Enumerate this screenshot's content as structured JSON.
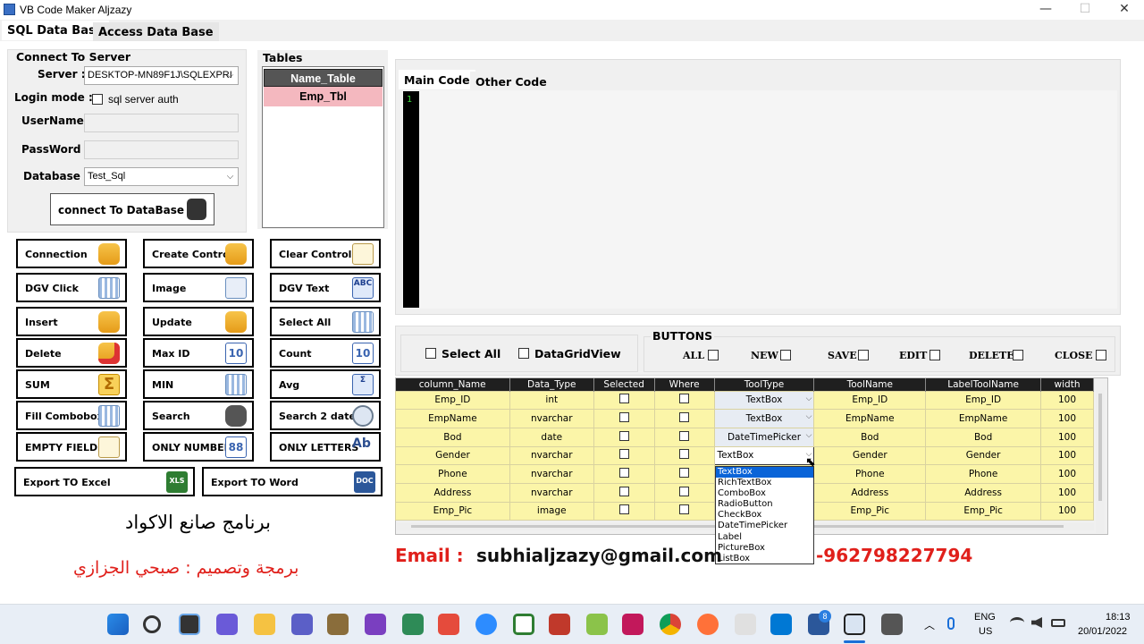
{
  "window": {
    "title": "VB Code Maker Aljzazy",
    "min": "—",
    "max": "☐",
    "close": "✕"
  },
  "tabs": [
    {
      "label": "SQL Data Base"
    },
    {
      "label": "Access Data Base"
    }
  ],
  "connect": {
    "group_title": "Connect To Server",
    "server_label": "Server :",
    "server_value": "DESKTOP-MN89F1J\\SQLEXPRI",
    "login_label": "Login mode :",
    "sql_auth_label": "sql server auth",
    "username_label": "UserName :",
    "password_label": "PassWord :",
    "database_label": "Database :",
    "database_value": "Test_Sql",
    "connect_button": "connect To DataBase"
  },
  "tables": {
    "group_title": "Tables",
    "header": "Name_Table",
    "items": [
      "Emp_Tbl"
    ]
  },
  "buttons": [
    "Connection",
    "Create Controls",
    "Clear Controls",
    "DGV Click",
    "Image",
    "DGV  Text",
    "Insert",
    "Update",
    "Select All",
    "Delete",
    "Max ID",
    "Count",
    "SUM",
    "MIN",
    "Avg",
    "Fill Combobox",
    "Search",
    "Search 2 date",
    "EMPTY FIELD",
    "ONLY NUMBER",
    "ONLY LETTERS",
    "Export TO Excel",
    "Export TO Word"
  ],
  "icons": {
    "Connection": "database-icon",
    "Create Controls": "gear-icon",
    "Clear Controls": "clipboard-icon",
    "DGV Click": "grid-icon",
    "Image": "image-icon",
    "DGV  Text": "abc-icon",
    "Insert": "database-gear-icon",
    "Update": "pencil-icon",
    "Select All": "grid-check-icon",
    "Delete": "database-delete-icon",
    "Max ID": "sort-icon",
    "Count": "count-icon",
    "SUM": "sigma-icon",
    "MIN": "grid-icon",
    "Avg": "sigma-icon",
    "Fill Combobox": "list-icon",
    "Search": "binoculars-icon",
    "Search 2 date": "clock-icon",
    "EMPTY FIELD": "document-delete-icon",
    "ONLY NUMBER": "number-icon",
    "ONLY LETTERS": "letters-icon",
    "Export TO Excel": "excel-icon",
    "Export TO Word": "word-icon"
  },
  "credits": {
    "app_name_ar": "برنامج صانع الاكواد",
    "author_ar": "برمجة وتصميم : صبحي الجزازي"
  },
  "code_tabs": [
    {
      "label": "Main Code"
    },
    {
      "label": "Other Code"
    }
  ],
  "editor": {
    "line_number": "1"
  },
  "options": {
    "select_all": "Select All",
    "datagridview": "DataGridView",
    "buttons_title": "BUTTONS",
    "buttons": [
      "ALL",
      "NEW",
      "SAVE",
      "EDIT",
      "DELETE",
      "CLOSE"
    ]
  },
  "grid": {
    "columns": [
      "column_Name",
      "Data_Type",
      "Selected",
      "Where",
      "ToolType",
      "ToolName",
      "LabelToolName",
      "width"
    ],
    "rows": [
      [
        "Emp_ID",
        "int",
        "",
        "",
        "TextBox",
        "Emp_ID",
        "Emp_ID",
        "100"
      ],
      [
        "EmpName",
        "nvarchar",
        "",
        "",
        "TextBox",
        "EmpName",
        "EmpName",
        "100"
      ],
      [
        "Bod",
        "date",
        "",
        "",
        "DateTimePicker",
        "Bod",
        "Bod",
        "100"
      ],
      [
        "Gender",
        "nvarchar",
        "",
        "",
        "TextBox",
        "Gender",
        "Gender",
        "100"
      ],
      [
        "Phone",
        "nvarchar",
        "",
        "",
        "",
        "Phone",
        "Phone",
        "100"
      ],
      [
        "Address",
        "nvarchar",
        "",
        "",
        "",
        "Address",
        "Address",
        "100"
      ],
      [
        "Emp_Pic",
        "image",
        "",
        "",
        "",
        "Emp_Pic",
        "Emp_Pic",
        "100"
      ]
    ],
    "dropdown_options": [
      "TextBox",
      "RichTextBox",
      "ComboBox",
      "RadioButton",
      "CheckBox",
      "DateTimePicker",
      "Label",
      "PictureBox",
      "ListBox"
    ],
    "dropdown_selected": "TextBox"
  },
  "contact": {
    "email_label": "Email :",
    "email": "subhialjzazy@gmail.com",
    "phone": "-962798227794"
  },
  "colors": {
    "accent_red": "#e0201b",
    "grid_yellow": "#fbf5a8",
    "selected_pink": "#f4b8bf",
    "dropdown_highlight": "#0a64d8"
  },
  "taskbar": {
    "lang": "ENG",
    "region": "US",
    "time": "18:13",
    "date": "20/01/2022",
    "badge": "8"
  }
}
